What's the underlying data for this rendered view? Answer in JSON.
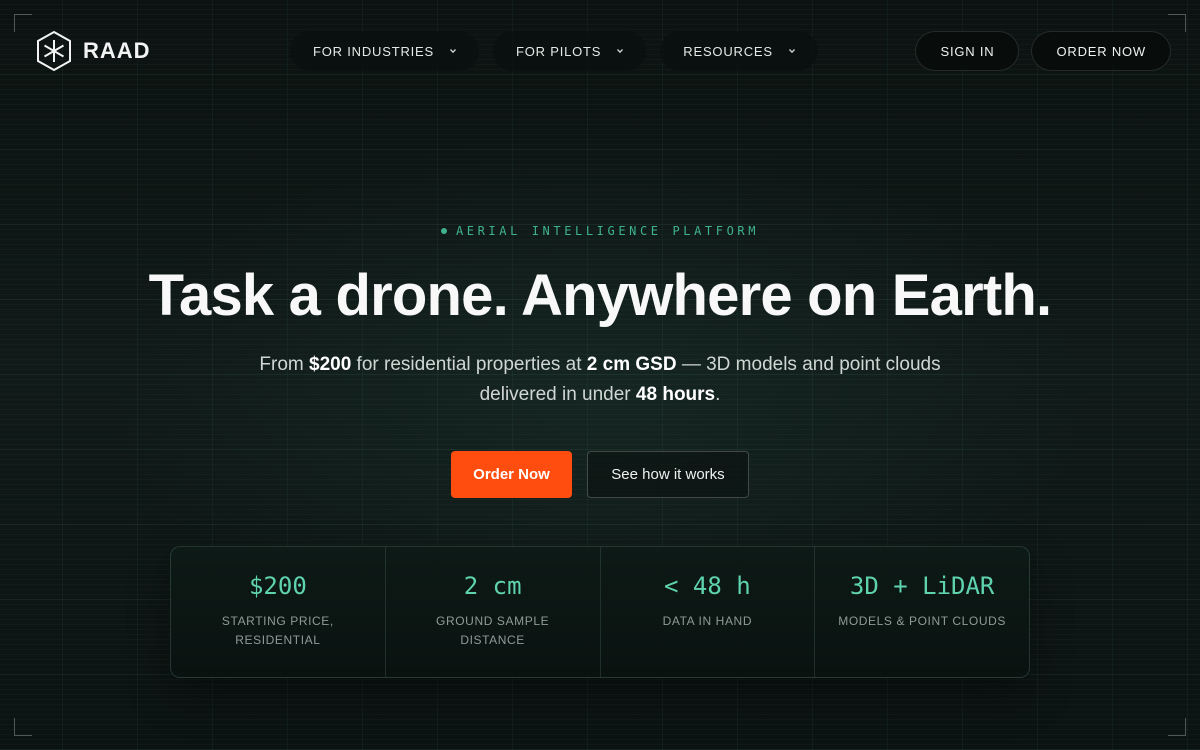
{
  "brand": {
    "name": "RAAD",
    "logo_icon": "hexagon-asterisk-icon"
  },
  "nav": {
    "items": [
      {
        "label": "FOR INDUSTRIES",
        "icon": "chevron-down-icon"
      },
      {
        "label": "FOR PILOTS",
        "icon": "chevron-down-icon"
      },
      {
        "label": "RESOURCES",
        "icon": "chevron-down-icon"
      }
    ]
  },
  "auth": {
    "sign_in": "SIGN IN",
    "order_now": "ORDER NOW"
  },
  "hero": {
    "eyebrow": "AERIAL INTELLIGENCE PLATFORM",
    "headline": "Task a drone. Anywhere on Earth.",
    "sub": {
      "p1": "From ",
      "price": "$200",
      "p2": " for residential properties at ",
      "gsd": "2 cm GSD",
      "p3": " — 3D models and point clouds delivered in under ",
      "time": "48 hours",
      "p4": "."
    },
    "cta_primary": "Order Now",
    "cta_secondary": "See how it works"
  },
  "stats": [
    {
      "value": "$200",
      "label": "STARTING PRICE, RESIDENTIAL"
    },
    {
      "value": "2 cm",
      "label": "GROUND SAMPLE DISTANCE"
    },
    {
      "value": "< 48 h",
      "label": "DATA IN HAND"
    },
    {
      "value": "3D + LiDAR",
      "label": "MODELS & POINT CLOUDS"
    }
  ],
  "colors": {
    "accent": "#ff4d0f",
    "mint": "#5fd3ae",
    "eyebrow": "#3fb38c",
    "background": "#0c1312"
  }
}
